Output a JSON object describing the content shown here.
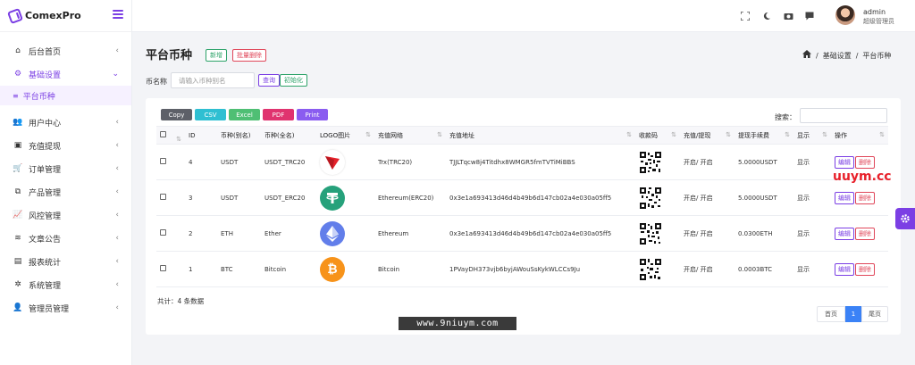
{
  "app": {
    "name": "ComexPro"
  },
  "sidebar": {
    "items": [
      {
        "label": "后台首页",
        "icon": "home-icon",
        "glyph": "⌂"
      },
      {
        "label": "基础设置",
        "icon": "cogs-icon",
        "glyph": "⚙"
      },
      {
        "label": "用户中心",
        "icon": "users-icon",
        "glyph": "👥"
      },
      {
        "label": "充值提现",
        "icon": "money-icon",
        "glyph": "▣"
      },
      {
        "label": "订单管理",
        "icon": "cart-icon",
        "glyph": "🛒"
      },
      {
        "label": "产品管理",
        "icon": "cubes-icon",
        "glyph": "⧉"
      },
      {
        "label": "风控管理",
        "icon": "chart-line-icon",
        "glyph": "📈"
      },
      {
        "label": "文章公告",
        "icon": "layers-icon",
        "glyph": "≋"
      },
      {
        "label": "报表统计",
        "icon": "database-icon",
        "glyph": "▤"
      },
      {
        "label": "系统管理",
        "icon": "gear-icon",
        "glyph": "✲"
      },
      {
        "label": "管理员管理",
        "icon": "user-group-icon",
        "glyph": "👤"
      }
    ],
    "sub_item": {
      "label": "平台币种",
      "icon": "list-icon",
      "glyph": "≡"
    },
    "chevron": "‹",
    "chevron_open": "⌄"
  },
  "topbar": {
    "icons": [
      "fullscreen-icon",
      "moon-icon",
      "camera-icon",
      "message-icon"
    ],
    "user_name": "admin",
    "user_role": "超级管理员"
  },
  "page": {
    "title": "平台币种",
    "new_label": "新增",
    "bulk_delete_label": "批量删除",
    "breadcrumb": [
      "/",
      "基础设置",
      "/",
      "平台币种"
    ]
  },
  "filter": {
    "label": "币名称",
    "placeholder": "请输入币种别名",
    "query_label": "查询",
    "init_label": "初始化"
  },
  "toolbar": {
    "export": [
      "Copy",
      "CSV",
      "Excel",
      "PDF",
      "Print"
    ],
    "search_label": "搜索："
  },
  "table": {
    "columns": [
      "ID",
      "币种(别名)",
      "币种(全名)",
      "LOGO图片",
      "充值网络",
      "充值地址",
      "收款码",
      "充值/提现",
      "提现手续费",
      "显示",
      "操作"
    ],
    "rows": [
      {
        "id": "4",
        "alias": "USDT",
        "full": "USDT_TRC20",
        "logo": "trx",
        "network": "Trx(TRC20)",
        "address": "TJJLTqcw8j4Titdhx8WMGR5fmTVTiMiBBS",
        "status": "开启/ 开启",
        "fee": "5.0000USDT",
        "show": "显示"
      },
      {
        "id": "3",
        "alias": "USDT",
        "full": "USDT_ERC20",
        "logo": "usdt",
        "network": "Ethereum(ERC20)",
        "address": "0x3e1a693413d46d4b49b6d147cb02a4e030a05ff5",
        "status": "开启/ 开启",
        "fee": "5.0000USDT",
        "show": "显示"
      },
      {
        "id": "2",
        "alias": "ETH",
        "full": "Ether",
        "logo": "eth",
        "network": "Ethereum",
        "address": "0x3e1a693413d46d4b49b6d147cb02a4e030a05ff5",
        "status": "开启/ 开启",
        "fee": "0.0300ETH",
        "show": "显示"
      },
      {
        "id": "1",
        "alias": "BTC",
        "full": "Bitcoin",
        "logo": "btc",
        "network": "Bitcoin",
        "address": "1PVayDH373vjb6byjAWouSsKykWLCCs9Ju",
        "status": "开启/ 开启",
        "fee": "0.0003BTC",
        "show": "显示"
      }
    ],
    "edit_label": "编辑",
    "delete_label": "删除"
  },
  "footer": {
    "total": "共计：4 条数据",
    "pager": [
      "首页",
      "1",
      "尾页"
    ]
  },
  "watermarks": {
    "site": "www.9niuym.com",
    "corner": "uuym.cc"
  },
  "colors": {
    "accent": "#7b3fe4",
    "success": "#2ea36a",
    "danger": "#e0475a",
    "page_active": "#3b82f6"
  }
}
